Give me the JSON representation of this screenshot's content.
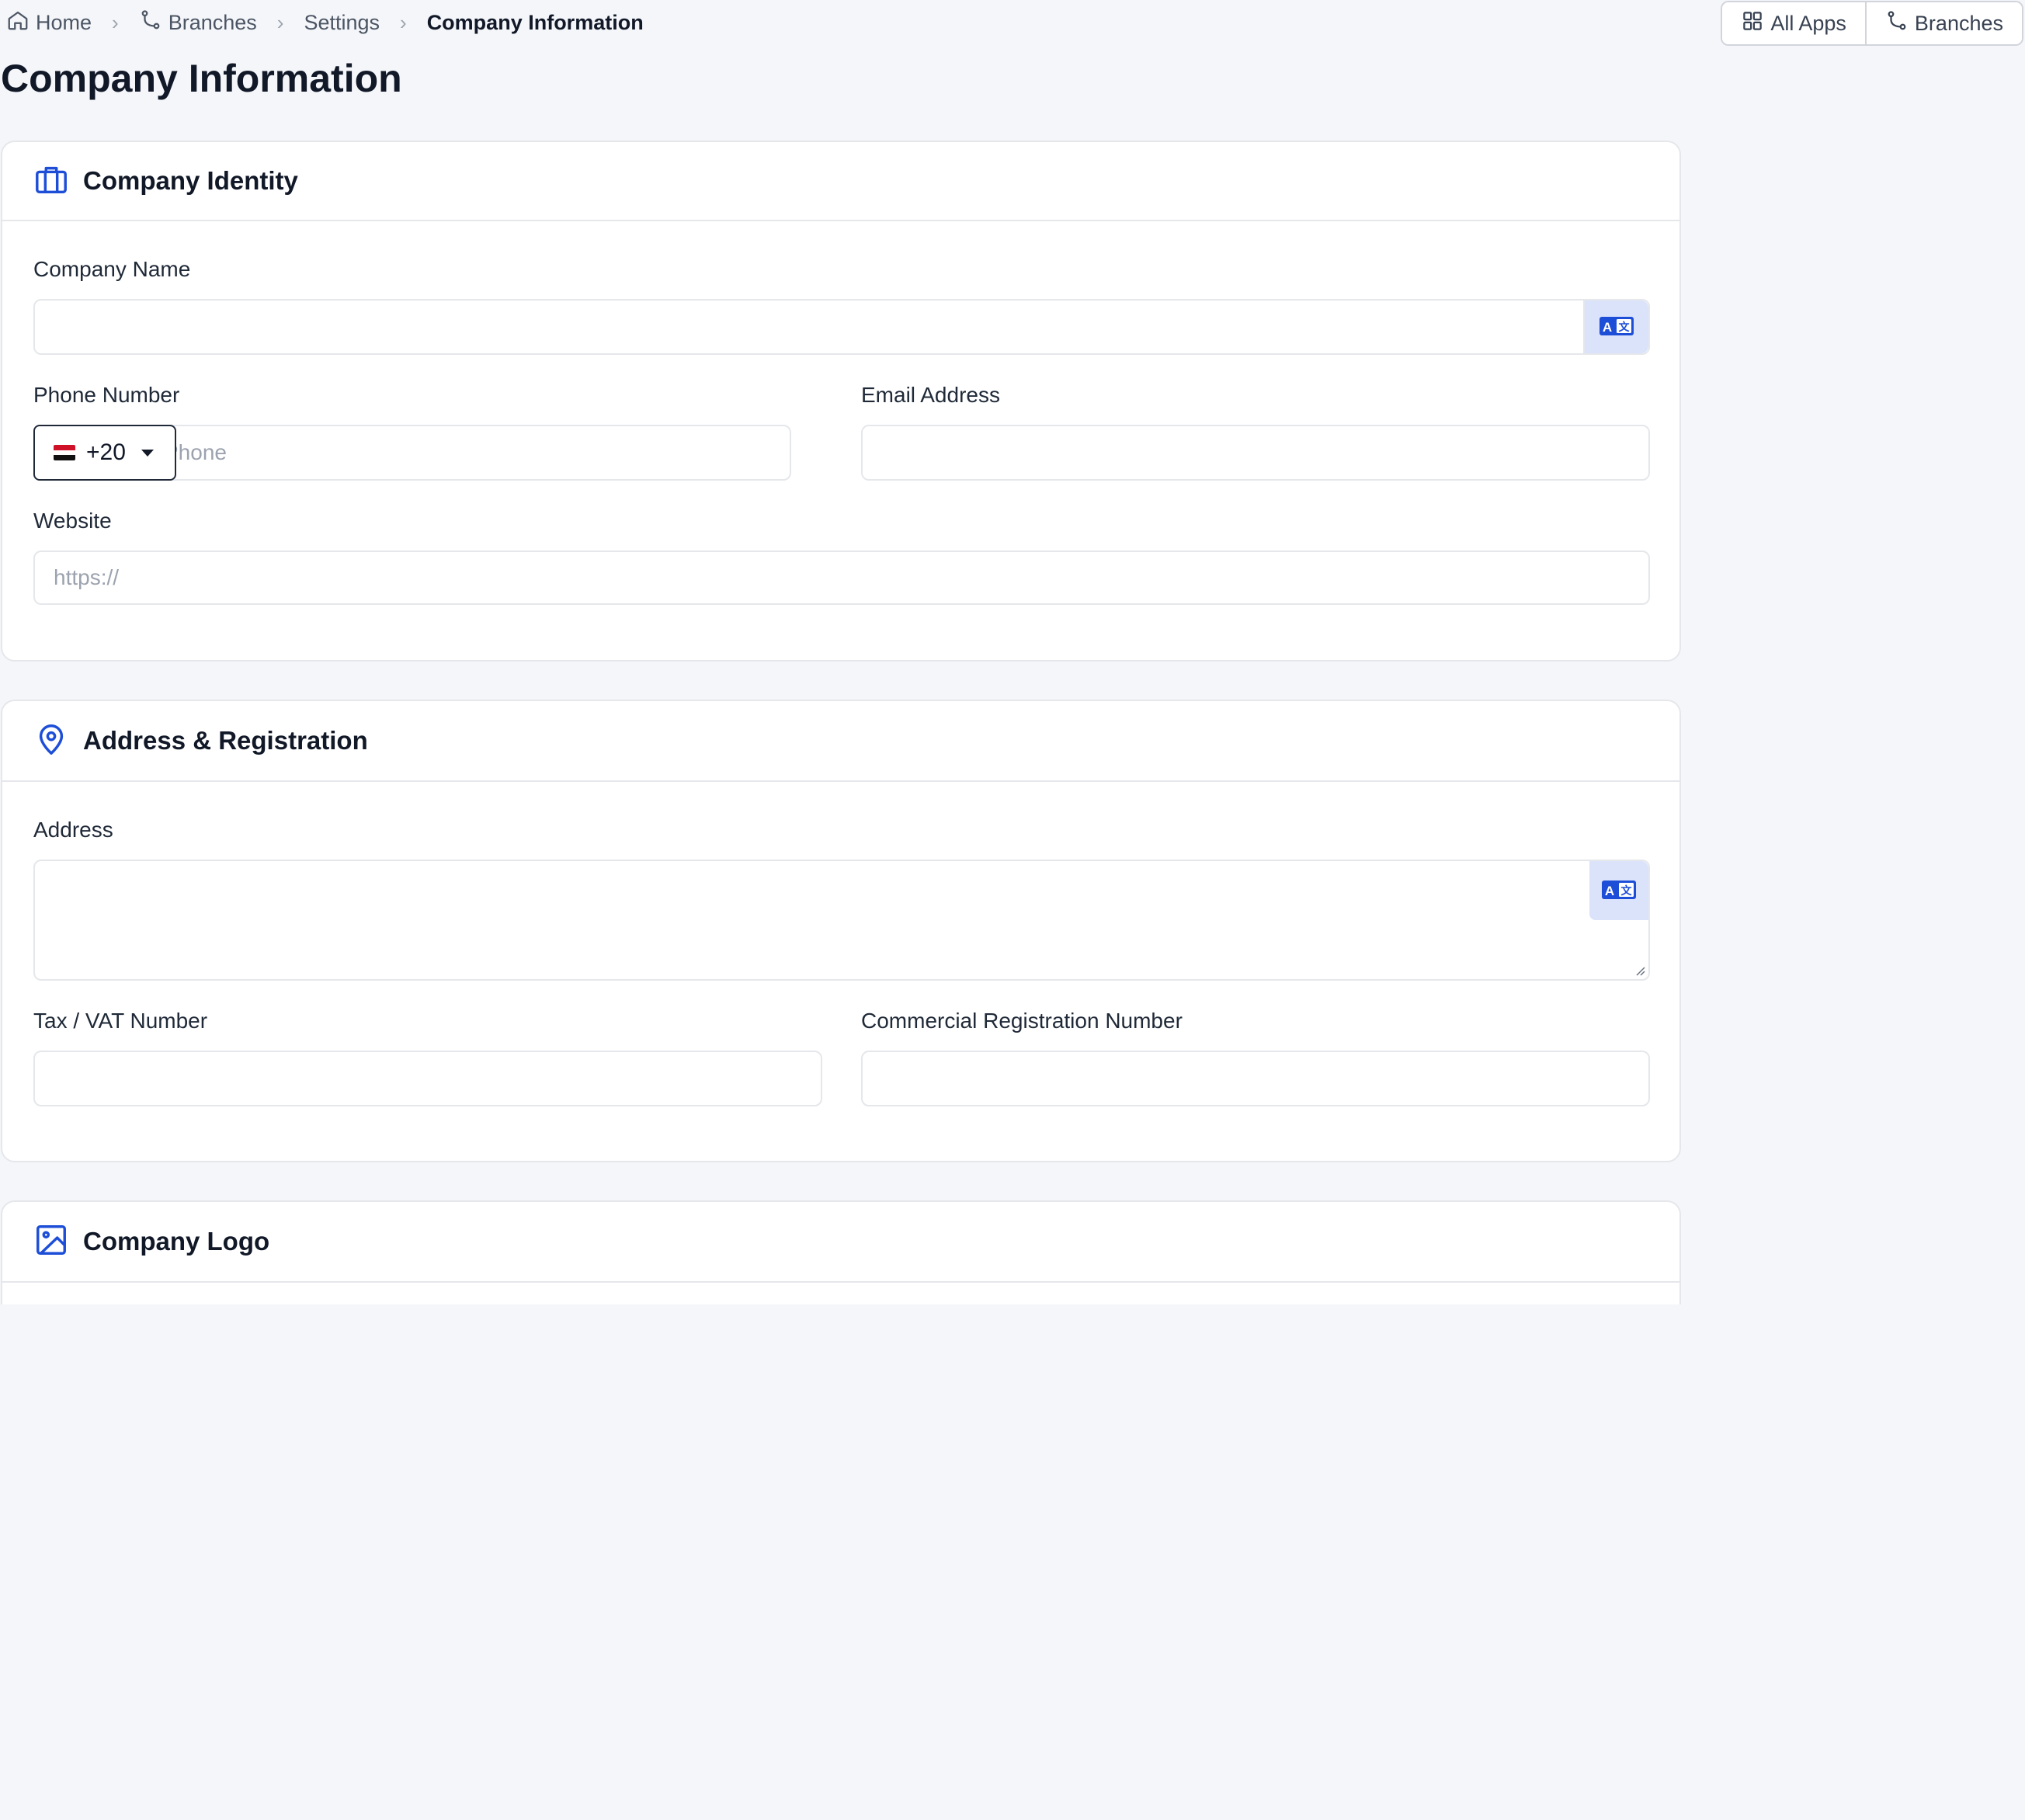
{
  "breadcrumb": {
    "items": [
      {
        "label": "Home",
        "icon": "home-icon"
      },
      {
        "label": "Branches",
        "icon": "branch-icon"
      },
      {
        "label": "Settings"
      },
      {
        "label": "Company Information"
      }
    ]
  },
  "top_actions": {
    "all_apps": {
      "label": "All Apps",
      "icon": "grid-icon"
    },
    "branches": {
      "label": "Branches",
      "icon": "branch-icon"
    }
  },
  "page": {
    "title": "Company Information"
  },
  "identity": {
    "title": "Company Identity",
    "icon": "briefcase-icon",
    "company_name": {
      "label": "Company Name",
      "value": "",
      "placeholder": ""
    },
    "phone": {
      "label": "Phone Number",
      "country_code": "+20",
      "country_flag": "flag-egypt-icon",
      "value": "",
      "placeholder": "Phone"
    },
    "email": {
      "label": "Email Address",
      "value": "",
      "placeholder": ""
    },
    "website": {
      "label": "Website",
      "value": "",
      "placeholder": "https://"
    }
  },
  "address": {
    "title": "Address & Registration",
    "icon": "map-pin-icon",
    "address": {
      "label": "Address",
      "value": ""
    },
    "tax": {
      "label": "Tax / VAT Number",
      "value": ""
    },
    "commercial": {
      "label": "Commercial Registration Number",
      "value": ""
    }
  },
  "logo": {
    "title": "Company Logo",
    "icon": "image-icon"
  },
  "colors": {
    "accent": "#1d4ed8",
    "translate_bg": "#dbe3fb",
    "page_bg": "#f5f6fa"
  }
}
